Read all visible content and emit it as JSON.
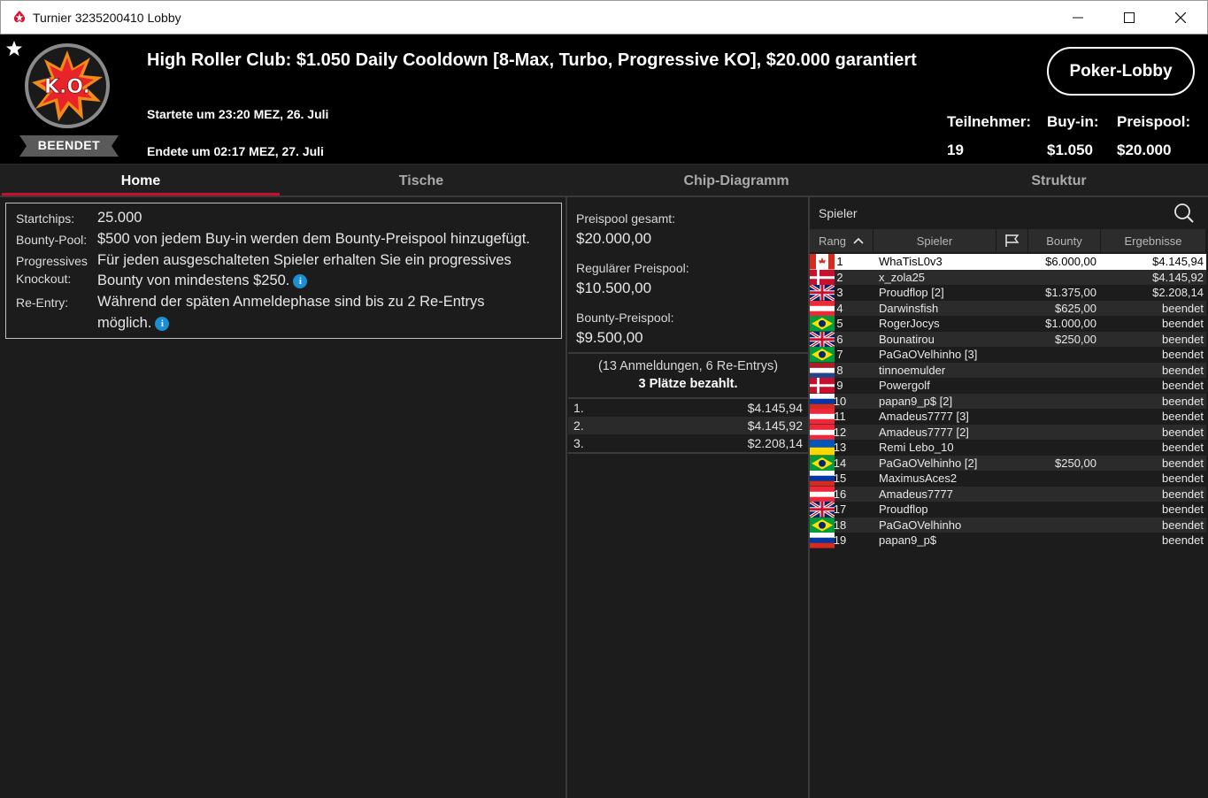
{
  "window": {
    "title": "Turnier 3235200410 Lobby",
    "minimize": "─",
    "maximize": "☐",
    "close": "✕"
  },
  "header": {
    "logo_text": "K.O.",
    "status": "BEENDET",
    "title": "High Roller Club: $1.050 Daily Cooldown [8-Max, Turbo, Progressive KO], $20.000 garantiert",
    "started": "Startete um 23:20 MEZ, 26. Juli",
    "ended": "Endete um 02:17 MEZ, 27. Juli",
    "lobby_button": "Poker-Lobby",
    "stats": {
      "participants_label": "Teilnehmer:",
      "participants_value": "19",
      "buyin_label": "Buy-in:",
      "buyin_value": "$1.050",
      "prizepool_label": "Preispool:",
      "prizepool_value": "$20.000"
    }
  },
  "tabs": [
    "Home",
    "Tische",
    "Chip-Diagramm",
    "Struktur"
  ],
  "info": {
    "startchips_label": "Startchips:",
    "startchips_value": "25.000",
    "bountypool_label": "Bounty-Pool:",
    "bountypool_value": "$500 von jedem Buy-in werden dem Bounty-Preispool hinzugefügt.",
    "pko_label_1": "Progressives",
    "pko_label_2": "Knockout:",
    "pko_value_1": "Für jeden ausgeschalteten Spieler erhalten Sie ein progressives",
    "pko_value_2": "Bounty von mindestens $250.",
    "reentry_label": "Re-Entry:",
    "reentry_value_1": "Während der späten Anmeldephase sind bis zu 2 Re-Entrys",
    "reentry_value_2": "möglich.",
    "info_glyph": "i"
  },
  "prizepool": {
    "total_label": "Preispool gesamt:",
    "total_value": "$20.000,00",
    "regular_label": "Regulärer Preispool:",
    "regular_value": "$10.500,00",
    "bounty_label": "Bounty-Preispool:",
    "bounty_value": "$9.500,00",
    "entries": "(13 Anmeldungen, 6 Re-Entrys)",
    "paid": "3 Plätze bezahlt.",
    "payouts": [
      {
        "pos": "1.",
        "amount": "$4.145,94"
      },
      {
        "pos": "2.",
        "amount": "$4.145,92"
      },
      {
        "pos": "3.",
        "amount": "$2.208,14"
      }
    ]
  },
  "players": {
    "title": "Spieler",
    "columns": {
      "rank": "Rang",
      "name": "Spieler",
      "bounty": "Bounty",
      "result": "Ergebnisse"
    },
    "rows": [
      {
        "rank": "1",
        "name": "WhaTisL0v3",
        "flag": "canada",
        "bounty": "$6.000,00",
        "result": "$4.145,94"
      },
      {
        "rank": "2",
        "name": "x_zola25",
        "flag": "denmark",
        "bounty": "",
        "result": "$4.145,92"
      },
      {
        "rank": "3",
        "name": "Proudflop [2]",
        "flag": "uk",
        "bounty": "$1.375,00",
        "result": "$2.208,14"
      },
      {
        "rank": "4",
        "name": "Darwinsfish",
        "flag": "austria",
        "bounty": "$625,00",
        "result": "beendet"
      },
      {
        "rank": "5",
        "name": "RogerJocys",
        "flag": "brazil",
        "bounty": "$1.000,00",
        "result": "beendet"
      },
      {
        "rank": "6",
        "name": "Bounatirou",
        "flag": "uk",
        "bounty": "$250,00",
        "result": "beendet"
      },
      {
        "rank": "7",
        "name": "PaGaOVelhinho [3]",
        "flag": "brazil",
        "bounty": "",
        "result": "beendet"
      },
      {
        "rank": "8",
        "name": "tinnoemulder",
        "flag": "netherlands",
        "bounty": "",
        "result": "beendet"
      },
      {
        "rank": "9",
        "name": "Powergolf",
        "flag": "denmark",
        "bounty": "",
        "result": "beendet"
      },
      {
        "rank": "10",
        "name": "papan9_p$ [2]",
        "flag": "russia",
        "bounty": "",
        "result": "beendet"
      },
      {
        "rank": "11",
        "name": "Amadeus7777 [3]",
        "flag": "austria",
        "bounty": "",
        "result": "beendet"
      },
      {
        "rank": "12",
        "name": "Amadeus7777 [2]",
        "flag": "austria",
        "bounty": "",
        "result": "beendet"
      },
      {
        "rank": "13",
        "name": "Remi Lebo_10",
        "flag": "ukraine",
        "bounty": "",
        "result": "beendet"
      },
      {
        "rank": "14",
        "name": "PaGaOVelhinho [2]",
        "flag": "brazil",
        "bounty": "$250,00",
        "result": "beendet"
      },
      {
        "rank": "15",
        "name": "MaximusAces2",
        "flag": "russia",
        "bounty": "",
        "result": "beendet"
      },
      {
        "rank": "16",
        "name": "Amadeus7777",
        "flag": "austria",
        "bounty": "",
        "result": "beendet"
      },
      {
        "rank": "17",
        "name": "Proudflop",
        "flag": "uk",
        "bounty": "",
        "result": "beendet"
      },
      {
        "rank": "18",
        "name": "PaGaOVelhinho",
        "flag": "brazil",
        "bounty": "",
        "result": "beendet"
      },
      {
        "rank": "19",
        "name": "papan9_p$",
        "flag": "russia",
        "bounty": "",
        "result": "beendet"
      }
    ]
  },
  "colors": {
    "accent": "#c8102e",
    "background": "#1c1c1c",
    "header": "#000000",
    "info_icon": "#1a8fd1"
  }
}
